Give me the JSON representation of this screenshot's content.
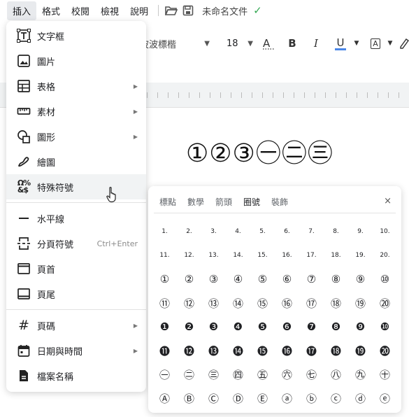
{
  "menubar": {
    "items": [
      "插入",
      "格式",
      "校閱",
      "檢視",
      "說明"
    ],
    "doc_name": "未命名文件",
    "icons": [
      "folder-open-icon",
      "save-icon",
      "check-icon"
    ]
  },
  "toolbar": {
    "font": "波波標楷",
    "size": "18",
    "bold": "B",
    "italic": "I",
    "underline": "U",
    "text_style": "A",
    "font_format": "A"
  },
  "document": {
    "text": "①②③㊀㊁㊂"
  },
  "insert_menu": {
    "items": [
      {
        "label": "文字框",
        "icon": "text-box-icon"
      },
      {
        "label": "圖片",
        "icon": "image-icon"
      },
      {
        "label": "表格",
        "icon": "table-icon",
        "submenu": true
      },
      {
        "label": "素材",
        "icon": "ruler-icon",
        "submenu": true
      },
      {
        "label": "圖形",
        "icon": "shapes-icon",
        "submenu": true
      },
      {
        "label": "繪圖",
        "icon": "draw-icon"
      },
      {
        "label": "特殊符號",
        "icon": "special-chars-icon",
        "highlighted": true
      },
      {
        "label": "水平線",
        "icon": "horizontal-line-icon"
      },
      {
        "label": "分頁符號",
        "icon": "page-break-icon",
        "shortcut": "Ctrl+Enter"
      },
      {
        "label": "頁首",
        "icon": "header-icon"
      },
      {
        "label": "頁尾",
        "icon": "footer-icon"
      },
      {
        "label": "頁碼",
        "icon": "hash-icon",
        "submenu": true
      },
      {
        "label": "日期與時間",
        "icon": "calendar-icon",
        "submenu": true
      },
      {
        "label": "檔案名稱",
        "icon": "file-icon"
      }
    ]
  },
  "special_chars": {
    "tabs": [
      "標點",
      "數學",
      "箭頭",
      "圈號",
      "裝飾"
    ],
    "active_tab": "圈號",
    "close": "×",
    "rows": [
      [
        "1.",
        "2.",
        "3.",
        "4.",
        "5.",
        "6.",
        "7.",
        "8.",
        "9.",
        "10."
      ],
      [
        "11.",
        "12.",
        "13.",
        "14.",
        "15.",
        "16.",
        "17.",
        "18.",
        "19.",
        "20."
      ],
      [
        "①",
        "②",
        "③",
        "④",
        "⑤",
        "⑥",
        "⑦",
        "⑧",
        "⑨",
        "⑩"
      ],
      [
        "⑪",
        "⑫",
        "⑬",
        "⑭",
        "⑮",
        "⑯",
        "⑰",
        "⑱",
        "⑲",
        "⑳"
      ],
      [
        "❶",
        "❷",
        "❸",
        "❹",
        "❺",
        "❻",
        "❼",
        "❽",
        "❾",
        "❿"
      ],
      [
        "⓫",
        "⓬",
        "⓭",
        "⓮",
        "⓯",
        "⓰",
        "⓱",
        "⓲",
        "⓳",
        "⓴"
      ],
      [
        "㊀",
        "㊁",
        "㊂",
        "㊃",
        "㊄",
        "㊅",
        "㊆",
        "㊇",
        "㊈",
        "㊉"
      ],
      [
        "Ⓐ",
        "Ⓑ",
        "Ⓒ",
        "Ⓓ",
        "Ⓔ",
        "ⓐ",
        "ⓑ",
        "ⓒ",
        "ⓓ",
        "ⓔ"
      ]
    ]
  }
}
